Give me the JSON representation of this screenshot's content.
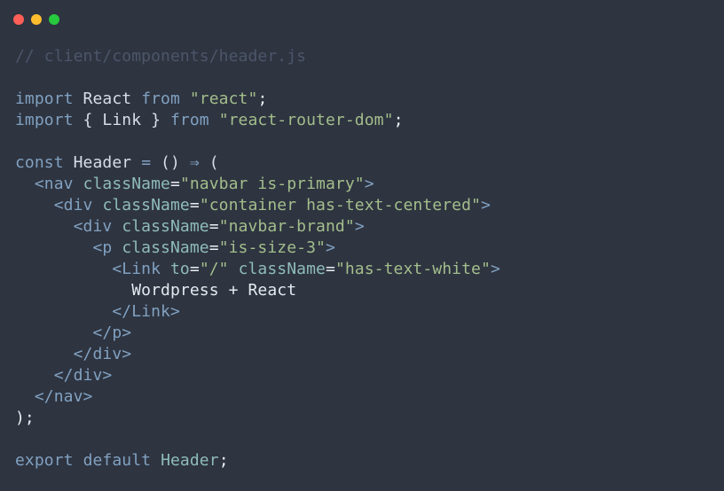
{
  "window": {
    "controls": [
      {
        "name": "close",
        "color": "#ff5f56"
      },
      {
        "name": "minimize",
        "color": "#ffbd2e"
      },
      {
        "name": "maximize",
        "color": "#27c93f"
      }
    ]
  },
  "colors": {
    "background": "#2e3440",
    "comment": "#4c566a",
    "keyword": "#81a1c1",
    "string": "#a3be8c",
    "text": "#d8dee9"
  },
  "code": {
    "lines": [
      [
        {
          "t": "// client/components/header.js",
          "k": "comment"
        }
      ],
      [],
      [
        {
          "t": "import",
          "k": "keyword"
        },
        {
          "t": " React ",
          "k": "ident"
        },
        {
          "t": "from",
          "k": "keyword"
        },
        {
          "t": " ",
          "k": "ident"
        },
        {
          "t": "\"react\"",
          "k": "string"
        },
        {
          "t": ";",
          "k": "punct"
        }
      ],
      [
        {
          "t": "import",
          "k": "keyword"
        },
        {
          "t": " { Link } ",
          "k": "ident"
        },
        {
          "t": "from",
          "k": "keyword"
        },
        {
          "t": " ",
          "k": "ident"
        },
        {
          "t": "\"react-router-dom\"",
          "k": "string"
        },
        {
          "t": ";",
          "k": "punct"
        }
      ],
      [],
      [
        {
          "t": "const",
          "k": "keyword"
        },
        {
          "t": " Header ",
          "k": "ident"
        },
        {
          "t": "=",
          "k": "op"
        },
        {
          "t": " () ",
          "k": "ident"
        },
        {
          "t": "⇒",
          "k": "op"
        },
        {
          "t": " (",
          "k": "ident"
        }
      ],
      [
        {
          "t": "  ",
          "k": "ident"
        },
        {
          "t": "<nav",
          "k": "tag"
        },
        {
          "t": " ",
          "k": "ident"
        },
        {
          "t": "className",
          "k": "attr"
        },
        {
          "t": "=",
          "k": "punct"
        },
        {
          "t": "\"navbar is-primary\"",
          "k": "string"
        },
        {
          "t": ">",
          "k": "tag"
        }
      ],
      [
        {
          "t": "    ",
          "k": "ident"
        },
        {
          "t": "<div",
          "k": "tag"
        },
        {
          "t": " ",
          "k": "ident"
        },
        {
          "t": "className",
          "k": "attr"
        },
        {
          "t": "=",
          "k": "punct"
        },
        {
          "t": "\"container has-text-centered\"",
          "k": "string"
        },
        {
          "t": ">",
          "k": "tag"
        }
      ],
      [
        {
          "t": "      ",
          "k": "ident"
        },
        {
          "t": "<div",
          "k": "tag"
        },
        {
          "t": " ",
          "k": "ident"
        },
        {
          "t": "className",
          "k": "attr"
        },
        {
          "t": "=",
          "k": "punct"
        },
        {
          "t": "\"navbar-brand\"",
          "k": "string"
        },
        {
          "t": ">",
          "k": "tag"
        }
      ],
      [
        {
          "t": "        ",
          "k": "ident"
        },
        {
          "t": "<p",
          "k": "tag"
        },
        {
          "t": " ",
          "k": "ident"
        },
        {
          "t": "className",
          "k": "attr"
        },
        {
          "t": "=",
          "k": "punct"
        },
        {
          "t": "\"is-size-3\"",
          "k": "string"
        },
        {
          "t": ">",
          "k": "tag"
        }
      ],
      [
        {
          "t": "          ",
          "k": "ident"
        },
        {
          "t": "<Link",
          "k": "tag"
        },
        {
          "t": " ",
          "k": "ident"
        },
        {
          "t": "to",
          "k": "attr"
        },
        {
          "t": "=",
          "k": "punct"
        },
        {
          "t": "\"/\"",
          "k": "string"
        },
        {
          "t": " ",
          "k": "ident"
        },
        {
          "t": "className",
          "k": "attr"
        },
        {
          "t": "=",
          "k": "punct"
        },
        {
          "t": "\"has-text-white\"",
          "k": "string"
        },
        {
          "t": ">",
          "k": "tag"
        }
      ],
      [
        {
          "t": "            Wordpress + React",
          "k": "text"
        }
      ],
      [
        {
          "t": "          ",
          "k": "ident"
        },
        {
          "t": "</Link>",
          "k": "tag"
        }
      ],
      [
        {
          "t": "        ",
          "k": "ident"
        },
        {
          "t": "</p>",
          "k": "tag"
        }
      ],
      [
        {
          "t": "      ",
          "k": "ident"
        },
        {
          "t": "</div>",
          "k": "tag"
        }
      ],
      [
        {
          "t": "    ",
          "k": "ident"
        },
        {
          "t": "</div>",
          "k": "tag"
        }
      ],
      [
        {
          "t": "  ",
          "k": "ident"
        },
        {
          "t": "</nav>",
          "k": "tag"
        }
      ],
      [
        {
          "t": ");",
          "k": "punct"
        }
      ],
      [],
      [
        {
          "t": "export",
          "k": "keyword"
        },
        {
          "t": " ",
          "k": "ident"
        },
        {
          "t": "default",
          "k": "keyword"
        },
        {
          "t": " ",
          "k": "ident"
        },
        {
          "t": "Header",
          "k": "class"
        },
        {
          "t": ";",
          "k": "punct"
        }
      ]
    ]
  }
}
